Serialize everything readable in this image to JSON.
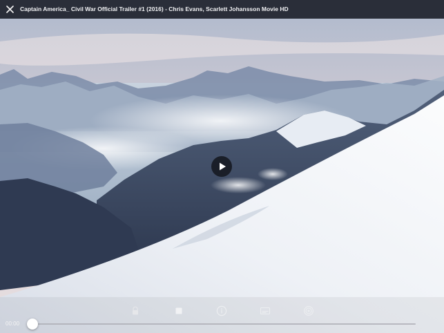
{
  "window": {
    "title": "Captain America_ Civil War Official Trailer #1 (2016) - Chris Evans, Scarlett Johansson Movie HD"
  },
  "icons": {
    "close": "close-icon",
    "play": "play-icon",
    "lock": "lock-icon",
    "stop": "stop-icon",
    "info": "info-icon",
    "subtitles": "subtitles-icon",
    "airplay": "airplay-icon"
  },
  "player": {
    "time_elapsed": "00:00",
    "time_remaining": "",
    "progress": 0
  },
  "colors": {
    "sky_top": "#b9c6d8",
    "snow": "#f3f5f8",
    "mountains": "#34415a"
  }
}
